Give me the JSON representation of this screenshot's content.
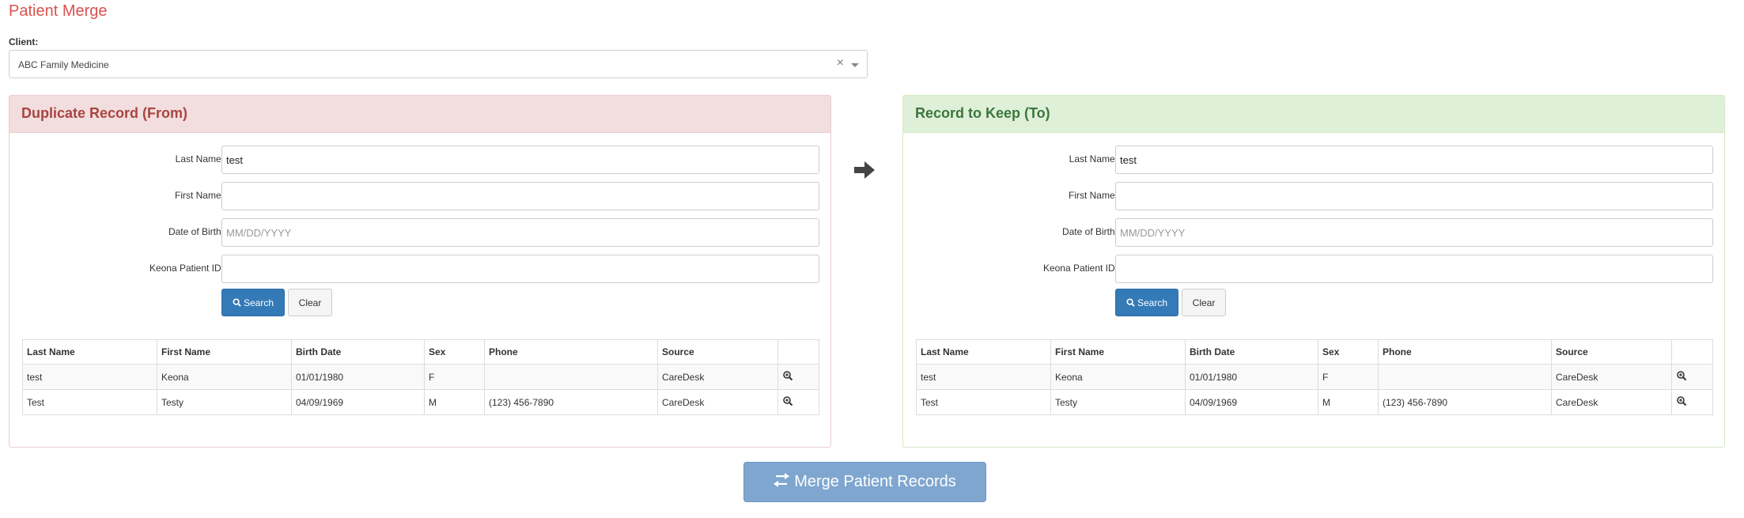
{
  "page": {
    "title": "Patient Merge"
  },
  "client": {
    "label": "Client:",
    "value": "ABC Family Medicine",
    "clear": "×"
  },
  "from_panel": {
    "title": "Duplicate Record (From)",
    "labels": {
      "last_name": "Last Name:",
      "first_name": "First Name:",
      "dob": "Date of Birth:",
      "patient_id": "Keona Patient ID:"
    },
    "values": {
      "last_name": "test",
      "first_name": "",
      "dob": "",
      "patient_id": ""
    },
    "dob_placeholder": "MM/DD/YYYY",
    "search_label": "Search",
    "clear_label": "Clear",
    "columns": [
      "Last Name",
      "First Name",
      "Birth Date",
      "Sex",
      "Phone",
      "Source"
    ],
    "rows": [
      {
        "last": "test",
        "first": "Keona",
        "birth": "01/01/1980",
        "sex": "F",
        "phone": "",
        "source": "CareDesk"
      },
      {
        "last": "Test",
        "first": "Testy",
        "birth": "04/09/1969",
        "sex": "M",
        "phone": "(123) 456-7890",
        "source": "CareDesk"
      }
    ]
  },
  "to_panel": {
    "title": "Record to Keep (To)",
    "labels": {
      "last_name": "Last Name:",
      "first_name": "First Name:",
      "dob": "Date of Birth:",
      "patient_id": "Keona Patient ID:"
    },
    "values": {
      "last_name": "test",
      "first_name": "",
      "dob": "",
      "patient_id": ""
    },
    "dob_placeholder": "MM/DD/YYYY",
    "search_label": "Search",
    "clear_label": "Clear",
    "columns": [
      "Last Name",
      "First Name",
      "Birth Date",
      "Sex",
      "Phone",
      "Source"
    ],
    "rows": [
      {
        "last": "test",
        "first": "Keona",
        "birth": "01/01/1980",
        "sex": "F",
        "phone": "",
        "source": "CareDesk"
      },
      {
        "last": "Test",
        "first": "Testy",
        "birth": "04/09/1969",
        "sex": "M",
        "phone": "(123) 456-7890",
        "source": "CareDesk"
      }
    ]
  },
  "merge_button": {
    "label": "Merge Patient Records"
  },
  "icons": {
    "arrow": "arrow-right-icon",
    "merge": "transfer-icon",
    "search": "search-icon",
    "view": "zoom-in-icon"
  },
  "colors": {
    "title": "#d9534f",
    "from_heading": "#a94442",
    "to_heading": "#3c763d",
    "primary": "#337ab7",
    "merge_button": "#7fa6cf"
  }
}
